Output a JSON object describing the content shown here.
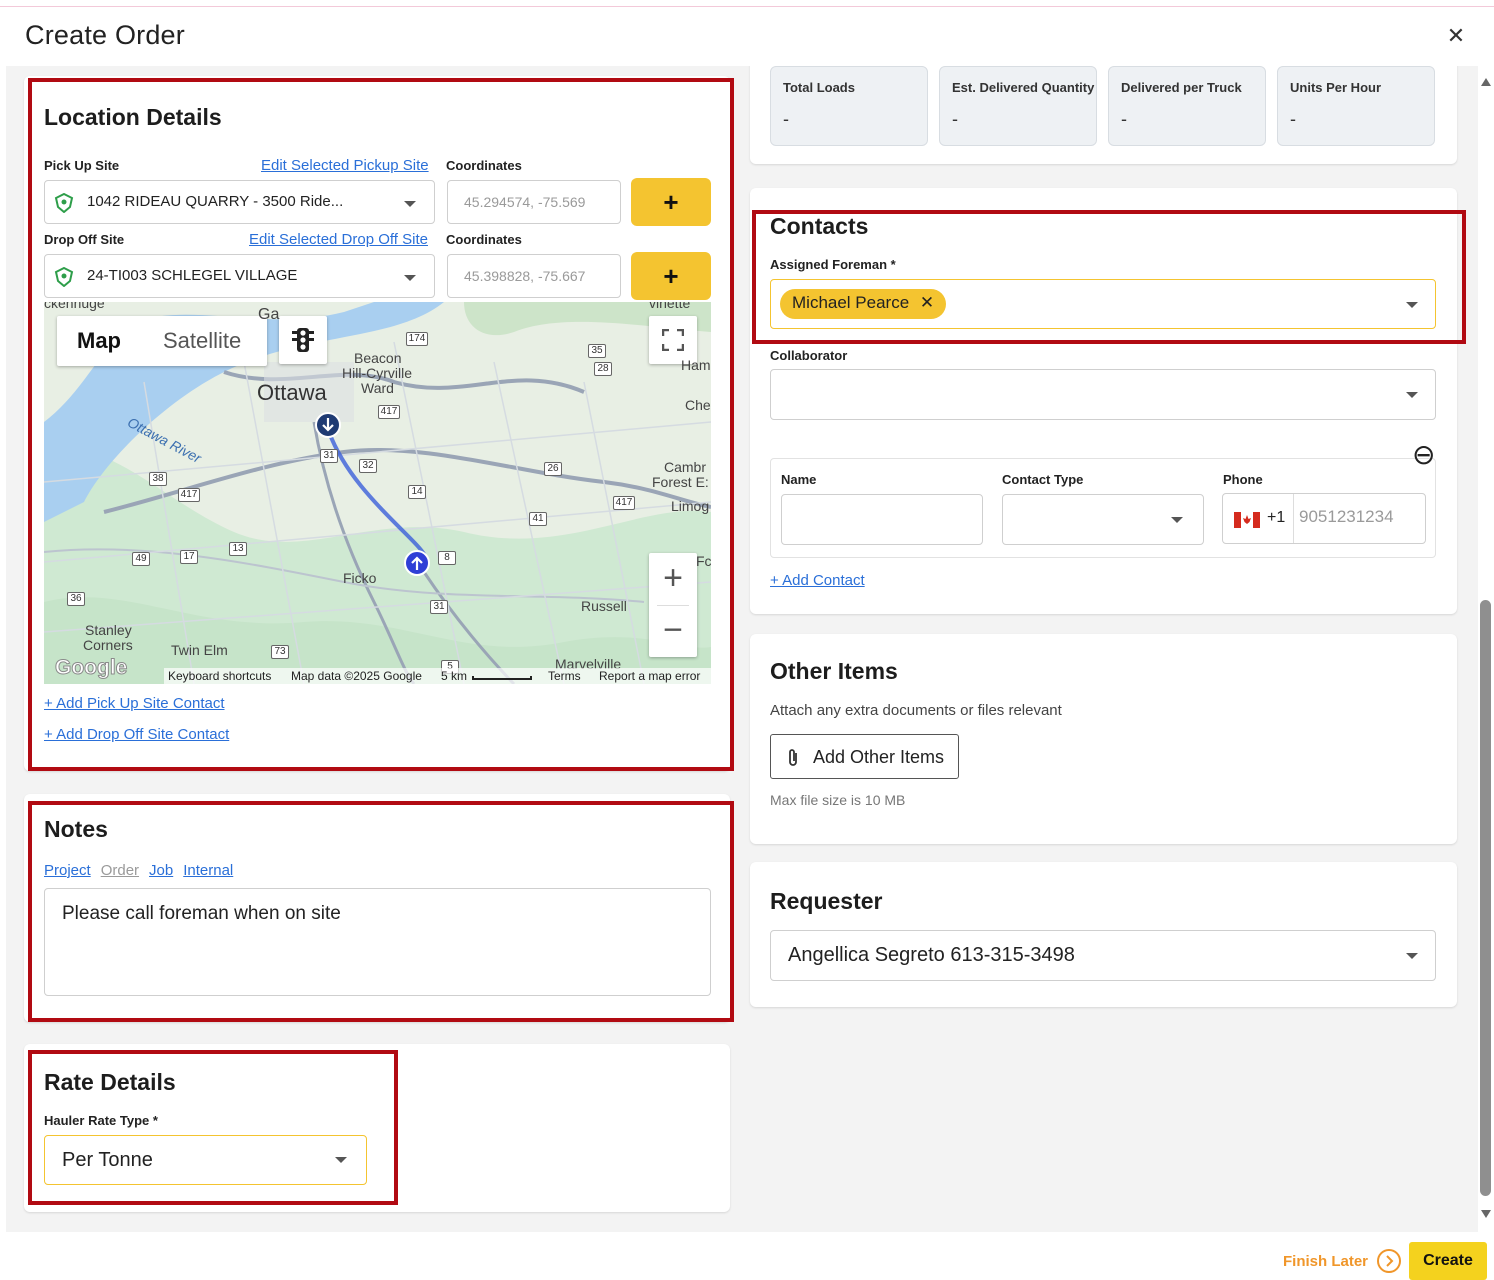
{
  "header": {
    "title": "Create Order",
    "close_glyph": "✕"
  },
  "location": {
    "title": "Location Details",
    "pickup": {
      "label": "Pick Up Site",
      "edit_link": "Edit Selected Pickup Site",
      "coord_label": "Coordinates",
      "site_value": "1042 RIDEAU QUARRY - 3500 Ride...",
      "coord_value": "45.294574, -75.569"
    },
    "dropoff": {
      "label": "Drop Off Site",
      "edit_link": "Edit Selected Drop Off Site",
      "coord_label": "Coordinates",
      "site_value": "24-TI003 SCHLEGEL VILLAGE",
      "coord_value": "45.398828, -75.667"
    },
    "add_button_glyph": "+",
    "map": {
      "tab_map": "Map",
      "tab_satellite": "Satellite",
      "labels": {
        "ottawa": "Ottawa",
        "beacon": "Beacon",
        "hill_cyrville": "Hill-Cyrville",
        "ward": "Ward",
        "ottawa_river": "Ottawa River",
        "ficko": "Ficko",
        "russell": "Russell",
        "stanley": "Stanley",
        "corners": "Corners",
        "twin_elm": "Twin Elm",
        "marvelville": "Marvelville",
        "cambr": "Cambr",
        "forest": "Forest E:",
        "limog": "Limog",
        "che": "Che",
        "fc": "Fc",
        "gat": "Ga",
        "kenridge": "ckenriuge",
        "vinette": "vinette",
        "ham": "Ham"
      },
      "shields": [
        "174",
        "35",
        "28",
        "417",
        "31",
        "32",
        "26",
        "38",
        "417",
        "14",
        "417",
        "41",
        "49",
        "17",
        "13",
        "8",
        "36",
        "31",
        "73",
        "5"
      ],
      "footer": {
        "google": "Google",
        "shortcuts": "Keyboard shortcuts",
        "data": "Map data ©2025 Google",
        "scale": "5 km",
        "terms": "Terms",
        "report": "Report a map error"
      },
      "zoom_in": "+",
      "zoom_out": "−"
    },
    "add_pickup_contact": "+ Add Pick Up Site Contact",
    "add_dropoff_contact": "+ Add Drop Off Site Contact"
  },
  "notes": {
    "title": "Notes",
    "tabs": [
      {
        "label": "Project",
        "active": true
      },
      {
        "label": "Order",
        "active": false
      },
      {
        "label": "Job",
        "active": true
      },
      {
        "label": "Internal",
        "active": true
      }
    ],
    "text": "Please call foreman when on site"
  },
  "rate": {
    "title": "Rate Details",
    "label": "Hauler Rate Type *",
    "value": "Per Tonne"
  },
  "stats": [
    {
      "title": "Total Loads",
      "value": "-"
    },
    {
      "title": "Est. Delivered Quantity",
      "value": "-"
    },
    {
      "title": "Delivered per Truck",
      "value": "-"
    },
    {
      "title": "Units Per Hour",
      "value": "-"
    }
  ],
  "contacts": {
    "title": "Contacts",
    "foreman_label": "Assigned Foreman *",
    "foreman_value": "Michael Pearce",
    "collaborator_label": "Collaborator",
    "name_label": "Name",
    "type_label": "Contact Type",
    "phone_label": "Phone",
    "phone_code": "+1",
    "phone_placeholder": "9051231234",
    "remove_glyph": "⊖",
    "add_contact": "+ Add Contact"
  },
  "other": {
    "title": "Other Items",
    "description": "Attach any extra documents or files relevant",
    "button": "Add Other Items",
    "note": "Max file size is 10 MB"
  },
  "requester": {
    "title": "Requester",
    "value": "Angellica Segreto 613-315-3498"
  },
  "footer": {
    "finish_later": "Finish Later",
    "create": "Create"
  },
  "colors": {
    "accent": "#f4c430",
    "highlight": "#b10a12",
    "link": "#2a6fd8"
  }
}
